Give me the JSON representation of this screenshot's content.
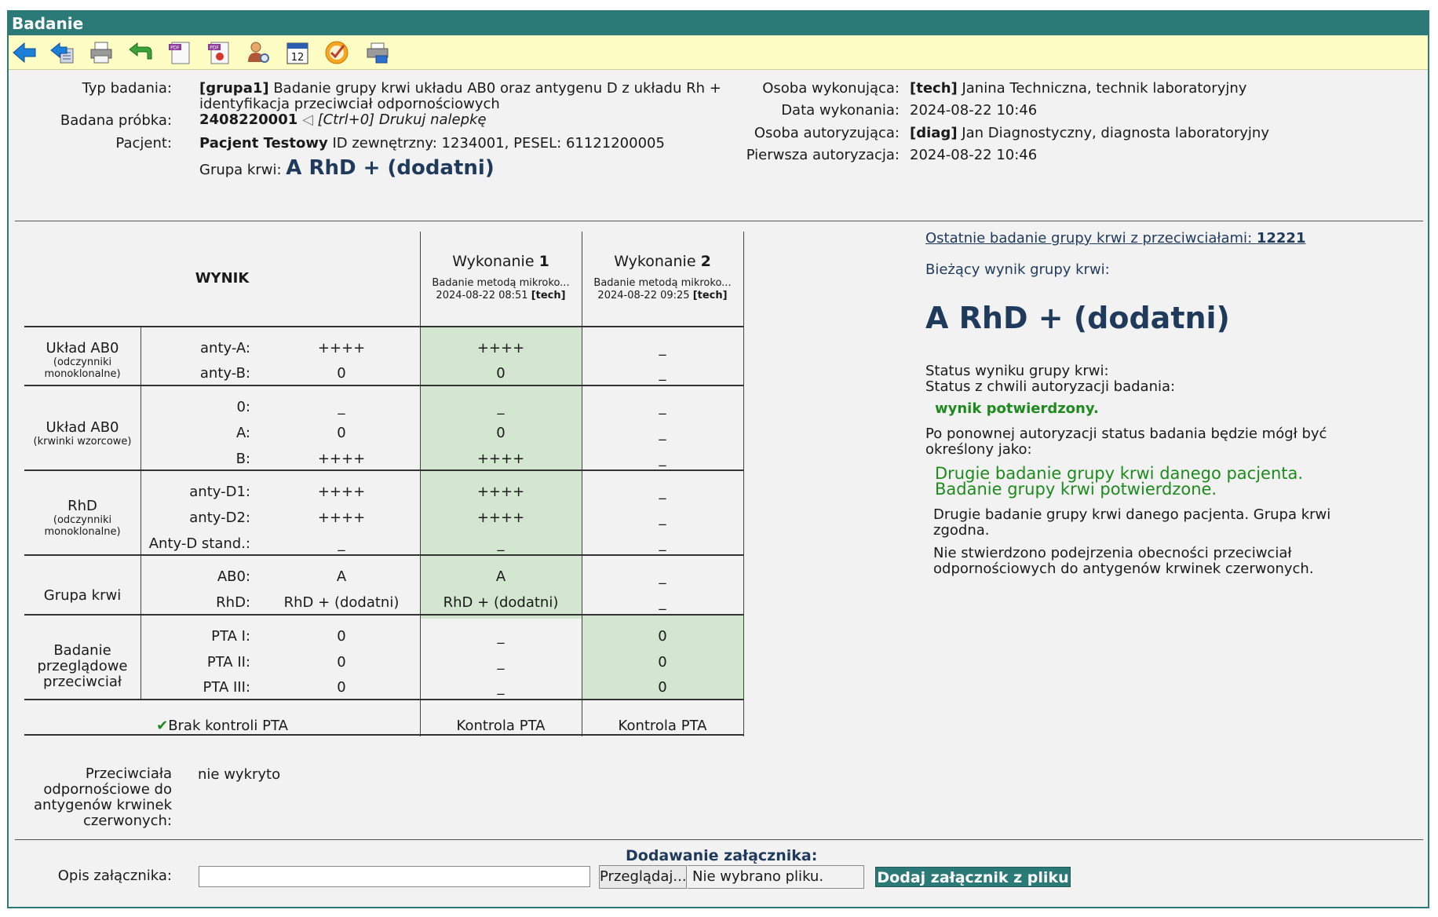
{
  "window": {
    "title": "Badanie"
  },
  "toolbar": {
    "icons": [
      "back-arrow-icon",
      "back-list-icon",
      "print-icon",
      "return-arrow-icon",
      "pdf-document-icon",
      "pdf-stamp-icon",
      "user-search-icon",
      "calendar-icon",
      "approve-check-icon",
      "printer-label-icon"
    ],
    "calendar_day": "12",
    "pdf_label": "PDF"
  },
  "header": {
    "typ_label": "Typ badania:",
    "typ_code": "[grupa1]",
    "typ_text1": " Badanie grupy krwi układu AB0 oraz antygenu D z układu Rh +",
    "typ_text2": "identyfikacja przeciwciał odpornościowych",
    "probka_label": "Badana próbka:",
    "probka_value": "2408220001",
    "probka_print": "[Ctrl+0] Drukuj nalepkę",
    "pacjent_label": "Pacjent:",
    "pacjent_name": "Pacjent Testowy",
    "pacjent_ids": " ID zewnętrzny: 1234001, PESEL: 61121200005",
    "grupa_label": "Grupa krwi:",
    "grupa_value": "A RhD + (dodatni)",
    "osoba_label": "Osoba wykonująca:",
    "osoba_code": "[tech]",
    "osoba_name": " Janina Techniczna, technik laboratoryjny",
    "data_label": "Data wykonania:",
    "data_value": "2024-08-22 10:46",
    "autor_label": "Osoba autoryzująca:",
    "autor_code": "[diag]",
    "autor_name": " Jan Diagnostyczny, diagnosta laboratoryjny",
    "pierwsza_label": "Pierwsza autoryzacja:",
    "pierwsza_value": "2024-08-22 10:46"
  },
  "table": {
    "wynik": "WYNIK",
    "wyk1_label": "Wykonanie ",
    "wyk1_num": "1",
    "wyk1_method": "Badanie metodą mikroko...",
    "wyk1_date": "2024-08-22 08:51 ",
    "wyk1_user": "[tech]",
    "wyk2_label": "Wykonanie ",
    "wyk2_num": "2",
    "wyk2_method": "Badanie metodą mikroko...",
    "wyk2_date": "2024-08-22 09:25 ",
    "wyk2_user": "[tech]",
    "s1_title": "Układ AB0",
    "s1_sub1": "(odczynniki",
    "s1_sub2": "monoklonalne)",
    "s2_title": "Układ AB0",
    "s2_sub": "(krwinki wzorcowe)",
    "s3_title": "RhD",
    "s3_sub1": "(odczynniki",
    "s3_sub2": "monoklonalne)",
    "s4_title": "Grupa krwi",
    "s5_l1": "Badanie",
    "s5_l2": "przeglądowe",
    "s5_l3": "przeciwciał",
    "rows": {
      "anty_a": "anty-A:",
      "anty_b": "anty-B:",
      "r0": "0:",
      "ra": "A:",
      "rb": "B:",
      "d1": "anty-D1:",
      "d2": "anty-D2:",
      "dstand": "Anty-D stand.:",
      "ab0": "AB0:",
      "rhd": "RhD:",
      "pta1": "PTA I:",
      "pta2": "PTA II:",
      "pta3": "PTA III:"
    },
    "vals": {
      "pppp": "++++",
      "zero": "0",
      "dash": "_",
      "a": "A",
      "rhd_plus": "RhD + (dodatni)"
    },
    "footer_check": "✔",
    "footer_brak": "Brak kontroli PTA",
    "footer_k1": "Kontrola PTA",
    "footer_k2": "Kontrola PTA"
  },
  "antibodies": {
    "l1": "Przeciwciała",
    "l2": "odpornościowe do",
    "l3": "antygenów krwinek",
    "l4": "czerwonych:",
    "value": "nie wykryto"
  },
  "right": {
    "last_label": "Ostatnie badanie grupy krwi z przeciwciałami: ",
    "last_num": "12221",
    "current_label": "Bieżący wynik grupy krwi:",
    "current_value": "A RhD + (dodatni)",
    "status1": "Status wyniku grupy krwi:",
    "status2": "Status z chwili autoryzacji badania:",
    "status_value": "wynik potwierdzony.",
    "after1": "Po ponownej autoryzacji status badania będzie mógł być",
    "after2": "określony jako:",
    "green1": "Drugie badanie grupy krwi danego pacjenta.",
    "green2": "Badanie grupy krwi potwierdzone.",
    "note1a": "Drugie badanie grupy krwi danego pacjenta. Grupa krwi",
    "note1b": "zgodna.",
    "note2a": "Nie stwierdzono podejrzenia obecności przeciwciał",
    "note2b": "odpornościowych do antygenów krwinek czerwonych."
  },
  "attachment": {
    "title": "Dodawanie załącznika:",
    "opis_label": "Opis załącznika:",
    "opis_value": "",
    "browse": "Przeglądaj...",
    "no_file": "Nie wybrano pliku.",
    "add": "Dodaj załącznik z pliku"
  },
  "colors": {
    "teal": "#2c7a78",
    "toolbar_bg": "#fefec4",
    "green_cell": "#d3e6d0",
    "status_green": "#1e8a1e",
    "dark_blue": "#1f3a5a"
  }
}
